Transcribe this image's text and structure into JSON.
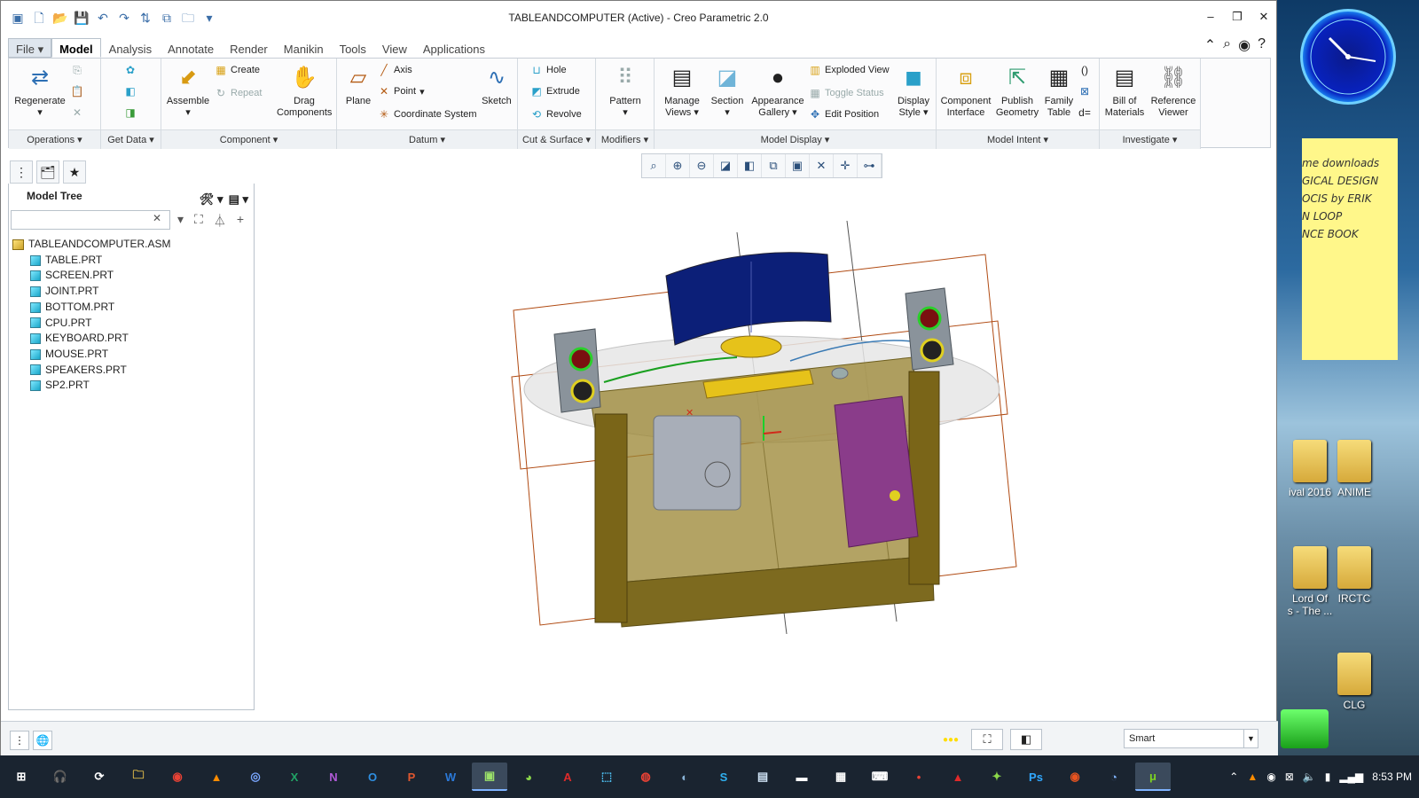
{
  "window": {
    "title": "TABLEANDCOMPUTER (Active) - Creo Parametric 2.0",
    "controls": [
      "minimize-icon",
      "restore-icon",
      "close-icon"
    ]
  },
  "quick_access": [
    "app-icon",
    "new-icon",
    "open-icon",
    "save-icon",
    "undo-icon",
    "redo-icon",
    "regenerate-icon",
    "windows-icon",
    "open-folder-icon",
    "customize-icon"
  ],
  "tabs": [
    {
      "label": "File",
      "kind": "file"
    },
    {
      "label": "Model",
      "kind": "active"
    },
    {
      "label": "Analysis",
      "kind": "normal"
    },
    {
      "label": "Annotate",
      "kind": "normal"
    },
    {
      "label": "Render",
      "kind": "normal"
    },
    {
      "label": "Manikin",
      "kind": "normal"
    },
    {
      "label": "Tools",
      "kind": "normal"
    },
    {
      "label": "View",
      "kind": "normal"
    },
    {
      "label": "Applications",
      "kind": "normal"
    }
  ],
  "ribbon": {
    "groups": {
      "operations": "Operations",
      "get_data": "Get Data",
      "component": "Component",
      "datum": "Datum",
      "cut_surface": "Cut & Surface",
      "modifiers": "Modifiers",
      "model_display": "Model Display",
      "model_intent": "Model Intent",
      "investigate": "Investigate"
    },
    "regenerate": "Regenerate",
    "assemble": "Assemble",
    "create": "Create",
    "repeat": "Repeat",
    "drag_components_1": "Drag",
    "drag_components_2": "Components",
    "plane": "Plane",
    "axis": "Axis",
    "point": "Point",
    "coordinate_system": "Coordinate System",
    "sketch": "Sketch",
    "hole": "Hole",
    "extrude": "Extrude",
    "revolve": "Revolve",
    "pattern": "Pattern",
    "manage_views_1": "Manage",
    "manage_views_2": "Views",
    "section": "Section",
    "appearance_gallery_1": "Appearance",
    "appearance_gallery_2": "Gallery",
    "exploded_view": "Exploded View",
    "toggle_status": "Toggle Status",
    "edit_position": "Edit Position",
    "display_style_1": "Display",
    "display_style_2": "Style",
    "component_interface_1": "Component",
    "component_interface_2": "Interface",
    "publish_geometry_1": "Publish",
    "publish_geometry_2": "Geometry",
    "family_table_1": "Family",
    "family_table_2": "Table",
    "bill_of_materials_1": "Bill of",
    "bill_of_materials_2": "Materials",
    "reference_viewer_1": "Reference",
    "reference_viewer_2": "Viewer"
  },
  "model_tree": {
    "title": "Model Tree",
    "search_value": "",
    "root": "TABLEANDCOMPUTER.ASM",
    "parts": [
      "TABLE.PRT",
      "SCREEN.PRT",
      "JOINT.PRT",
      "BOTTOM.PRT",
      "CPU.PRT",
      "KEYBOARD.PRT",
      "MOUSE.PRT",
      "SPEAKERS.PRT",
      "SP2.PRT"
    ]
  },
  "view_toolbar": [
    "refit-icon",
    "zoom-in-icon",
    "zoom-out-icon",
    "repaint-icon",
    "display-style-icon",
    "saved-orientations-icon",
    "view-manager-icon",
    "datum-display-icon",
    "spin-center-icon",
    "annotation-display-icon"
  ],
  "status_bar": {
    "filter_value": "Smart"
  },
  "desktop": {
    "sticky_lines": [
      "me downloads",
      "GICAL DESIGN",
      "OCIS by ERIK",
      "",
      "N LOOP",
      "NCE BOOK"
    ],
    "icons": [
      {
        "label": "ival 2016"
      },
      {
        "label": "ANIME"
      },
      {
        "label": "Lord Of\ns - The ..."
      },
      {
        "label": "IRCTC"
      },
      {
        "label": "CLG"
      }
    ]
  },
  "taskbar": {
    "apps": [
      "start-icon",
      "cortana-icon",
      "task-view-icon",
      "file-explorer-icon",
      "chrome-icon",
      "vlc-icon",
      "browser-icon",
      "excel-icon",
      "onenote-icon",
      "outlook-icon",
      "powerpoint-icon",
      "word-icon",
      "creo-icon",
      "android-icon",
      "acrobat-icon",
      "store-icon",
      "media-icon",
      "steam-icon",
      "skype-icon",
      "notepad-icon",
      "terminal-icon",
      "calculator-icon",
      "keyboard-icon",
      "media-player-icon",
      "acrobat2-icon",
      "app-2016-icon",
      "photoshop-icon",
      "ubuntu-icon",
      "clock-icon",
      "utorrent-icon"
    ],
    "time": "8:53 PM"
  }
}
